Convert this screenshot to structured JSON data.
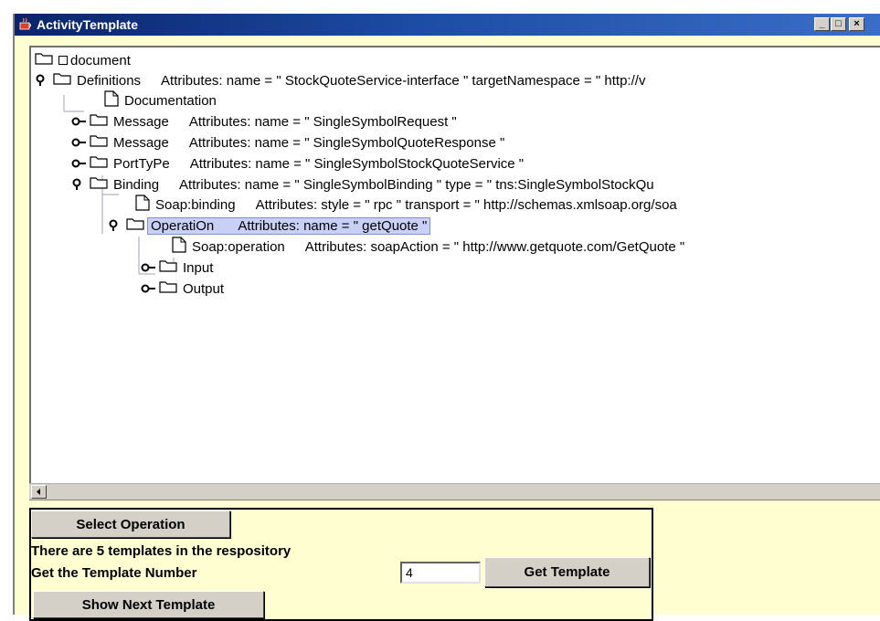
{
  "window": {
    "title": "ActivityTemplate",
    "controls": [
      "_",
      "□",
      "×"
    ]
  },
  "tree": {
    "root_label": "document",
    "nodes": [
      {
        "label": "Definitions",
        "attrs": "Attributes:  name = \" StockQuoteService-interface \"   targetNamespace = \" http://v"
      },
      {
        "label": "Documentation",
        "attrs": ""
      },
      {
        "label": "Message",
        "attrs": "Attributes:  name = \" SingleSymbolRequest \""
      },
      {
        "label": "Message",
        "attrs": "Attributes:  name = \" SingleSymbolQuoteResponse \""
      },
      {
        "label": "PortTyPe",
        "attrs": "Attributes:  name = \" SingleSymbolStockQuoteService \""
      },
      {
        "label": "Binding",
        "attrs": "Attributes:  name = \" SingleSymbolBinding \"   type = \" tns:SingleSymbolStockQu"
      },
      {
        "label": "Soap:binding",
        "attrs": "Attributes:  style = \" rpc \"   transport = \" http://schemas.xmlsoap.org/soa"
      },
      {
        "label": "OperatiOn",
        "attrs": "Attributes:  name = \" getQuote \""
      },
      {
        "label": "Soap:operation",
        "attrs": "Attributes:  soapAction = \" http://www.getquote.com/GetQuote \""
      },
      {
        "label": "Input",
        "attrs": ""
      },
      {
        "label": "Output",
        "attrs": ""
      }
    ]
  },
  "panel": {
    "select_operation_label": "Select Operation",
    "info_text": "There are 5 templates in the respository",
    "get_number_label": "Get the Template Number",
    "template_number_value": "4",
    "get_template_label": "Get Template",
    "show_next_label": "Show Next Template"
  },
  "colors": {
    "titlebar": "#0a246a",
    "background": "#fefed0",
    "selection": "#c8d0f5"
  }
}
